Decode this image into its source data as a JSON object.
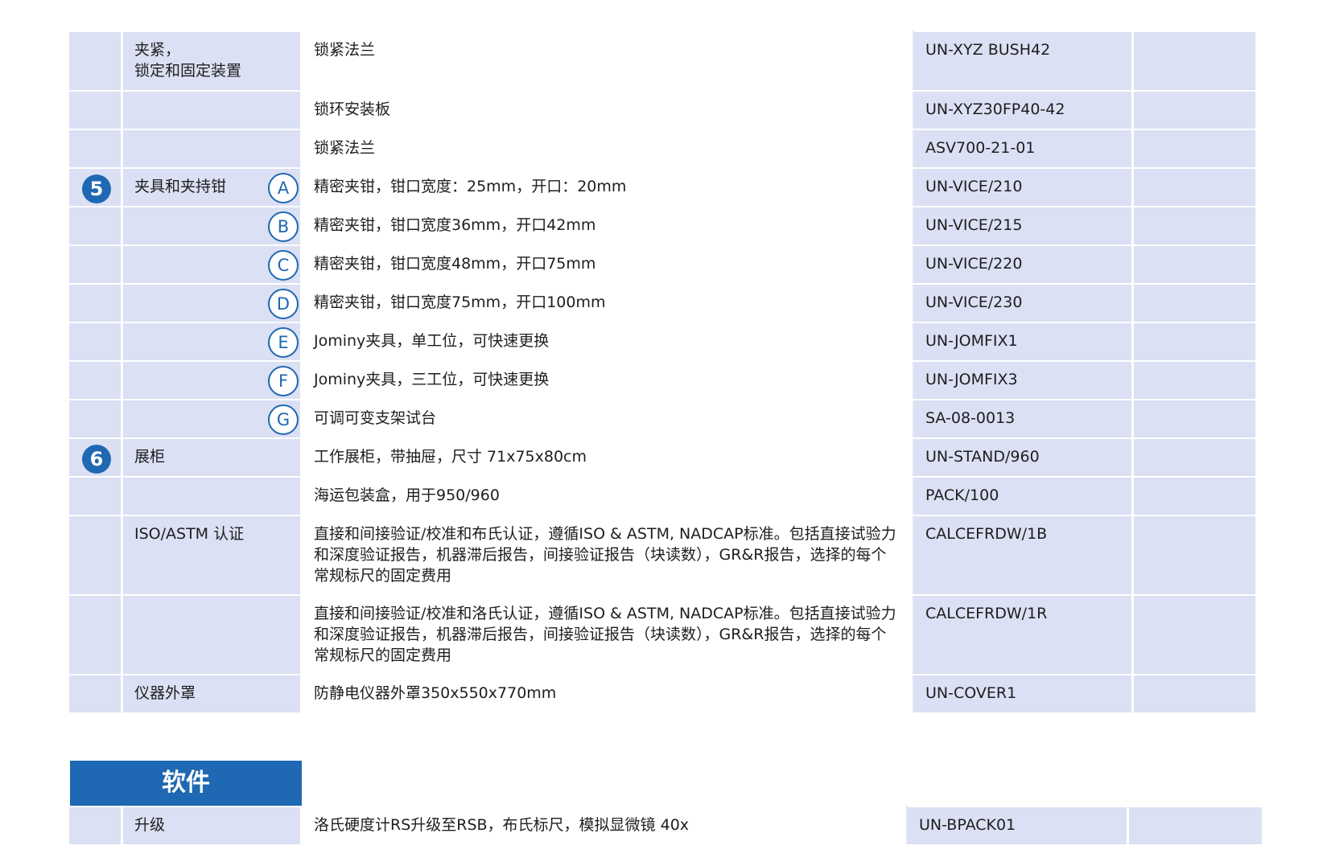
{
  "rows": [
    {
      "num": "",
      "cat": "夹紧，\n锁定和固定装置",
      "letter": "",
      "desc": "锁紧法兰",
      "code": "UN-XYZ BUSH42"
    },
    {
      "num": "",
      "cat": "",
      "letter": "",
      "desc": "锁环安装板",
      "code": "UN-XYZ30FP40-42"
    },
    {
      "num": "",
      "cat": "",
      "letter": "",
      "desc": "锁紧法兰",
      "code": "ASV700-21-01"
    },
    {
      "num": "5",
      "cat": "夹具和夹持钳",
      "letter": "A",
      "desc": "精密夹钳，钳口宽度：25mm，开口：20mm",
      "code": "UN-VICE/210"
    },
    {
      "num": "",
      "cat": "",
      "letter": "B",
      "desc": "精密夹钳，钳口宽度36mm，开口42mm",
      "code": "UN-VICE/215"
    },
    {
      "num": "",
      "cat": "",
      "letter": "C",
      "desc": "精密夹钳，钳口宽度48mm，开口75mm",
      "code": "UN-VICE/220"
    },
    {
      "num": "",
      "cat": "",
      "letter": "D",
      "desc": "精密夹钳，钳口宽度75mm，开口100mm",
      "code": "UN-VICE/230"
    },
    {
      "num": "",
      "cat": "",
      "letter": "E",
      "desc": "Jominy夹具，单工位，可快速更换",
      "code": "UN-JOMFIX1"
    },
    {
      "num": "",
      "cat": "",
      "letter": "F",
      "desc": "Jominy夹具，三工位，可快速更换",
      "code": "UN-JOMFIX3"
    },
    {
      "num": "",
      "cat": "",
      "letter": "G",
      "desc": "可调可变支架试台",
      "code": "SA-08-0013"
    },
    {
      "num": "6",
      "cat": "展柜",
      "letter": "",
      "desc": "工作展柜，带抽屉，尺寸 71x75x80cm",
      "code": "UN-STAND/960"
    },
    {
      "num": "",
      "cat": "",
      "letter": "",
      "desc": "海运包装盒，用于950/960",
      "code": "PACK/100"
    },
    {
      "num": "",
      "cat": "ISO/ASTM 认证",
      "letter": "",
      "desc": "直接和间接验证/校准和布氏认证，遵循ISO & ASTM, NADCAP标准。包括直接试验力和深度验证报告，机器滞后报告，间接验证报告（块读数），GR&R报告，选择的每个常规标尺的固定费用",
      "code": "CALCEFRDW/1B"
    },
    {
      "num": "",
      "cat": "",
      "letter": "",
      "desc": "直接和间接验证/校准和洛氏认证，遵循ISO & ASTM, NADCAP标准。包括直接试验力和深度验证报告，机器滞后报告，间接验证报告（块读数），GR&R报告，选择的每个常规标尺的固定费用",
      "code": "CALCEFRDW/1R"
    },
    {
      "num": "",
      "cat": "仪器外罩",
      "letter": "",
      "desc": "防静电仪器外罩350x550x770mm",
      "code": "UN-COVER1"
    }
  ],
  "software": {
    "title": "软件",
    "row": {
      "cat": "升级",
      "desc": "洛氏硬度计RS升级至RSB，布氏标尺，模拟显微镜 40x",
      "code": "UN-BPACK01"
    }
  }
}
